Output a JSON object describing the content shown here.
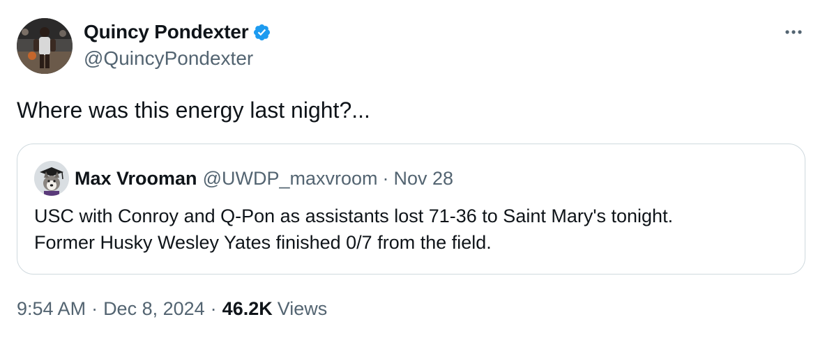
{
  "author": {
    "display_name": "Quincy Pondexter",
    "handle": "@QuincyPondexter",
    "verified": true,
    "avatar_icon": "basketball-player-photo"
  },
  "menu": {
    "more_icon": "more-horizontal-icon"
  },
  "tweet": {
    "text": "Where was this energy last night?..."
  },
  "quote": {
    "display_name": "Max Vrooman",
    "handle": "@UWDP_maxvroom",
    "separator": "·",
    "date": "Nov 28",
    "avatar_icon": "husky-graduate-avatar",
    "text_lines": [
      "USC with Conroy and Q-Pon as assistants lost 71-36 to Saint Mary's tonight.",
      "Former Husky Wesley Yates finished 0/7 from the field."
    ]
  },
  "meta": {
    "time": "9:54 AM",
    "separator": "·",
    "date": "Dec 8, 2024",
    "views_count": "46.2K",
    "views_label": "Views"
  },
  "colors": {
    "primary_text": "#0f1419",
    "secondary_text": "#536471",
    "verified_blue": "#1d9bf0",
    "border": "#cfd9de"
  }
}
